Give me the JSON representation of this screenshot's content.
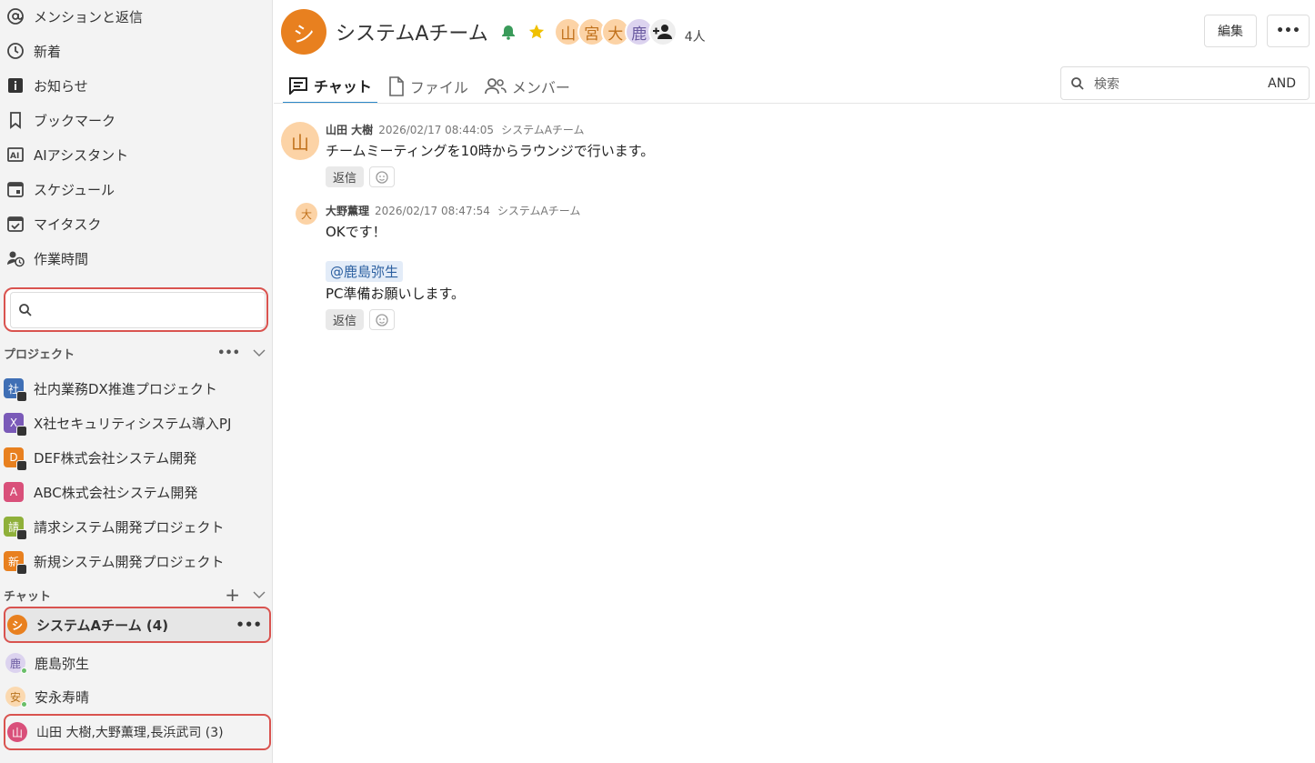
{
  "sidebar": {
    "nav": [
      {
        "label": "メンションと返信",
        "icon": "at-icon"
      },
      {
        "label": "新着",
        "icon": "clock-icon"
      },
      {
        "label": "お知らせ",
        "icon": "info-icon"
      },
      {
        "label": "ブックマーク",
        "icon": "bookmark-icon"
      },
      {
        "label": "AIアシスタント",
        "icon": "ai-icon"
      },
      {
        "label": "スケジュール",
        "icon": "calendar-icon"
      },
      {
        "label": "マイタスク",
        "icon": "task-icon"
      },
      {
        "label": "作業時間",
        "icon": "work-time-icon"
      }
    ],
    "search_placeholder": "",
    "projects_header": "プロジェクト",
    "projects": [
      {
        "label": "社内業務DX推進プロジェクト",
        "initial": "社",
        "color": "#3f6fb5"
      },
      {
        "label": "X社セキュリティシステム導入PJ",
        "initial": "X",
        "color": "#7a5ab8"
      },
      {
        "label": "DEF株式会社システム開発",
        "initial": "D",
        "color": "#e8801f"
      },
      {
        "label": "ABC株式会社システム開発",
        "initial": "A",
        "color": "#d9507a"
      },
      {
        "label": "請求システム開発プロジェクト",
        "initial": "請",
        "color": "#8fb03a"
      },
      {
        "label": "新規システム開発プロジェクト",
        "initial": "新",
        "color": "#e8801f"
      }
    ],
    "chat_header": "チャット",
    "chats": [
      {
        "label": "システムAチーム (4)",
        "initial": "シ",
        "bg": "#e8801f",
        "fg": "#ffffff"
      },
      {
        "label": "鹿島弥生",
        "initial": "鹿",
        "bg": "#dcd3ef",
        "fg": "#6a5aa0"
      },
      {
        "label": "安永寿晴",
        "initial": "安",
        "bg": "#fbd9b0",
        "fg": "#b8741f"
      },
      {
        "label": "山田 大樹,大野薫理,長浜武司 (3)",
        "initial": "山",
        "bg": "#d9507a",
        "fg": "#ffffff"
      }
    ]
  },
  "header": {
    "avatar_initial": "シ",
    "title": "システムAチーム",
    "members": [
      {
        "initial": "山",
        "bg": "#fcd3a6",
        "fg": "#c0701a"
      },
      {
        "initial": "宮",
        "bg": "#fcd3a6",
        "fg": "#c0701a"
      },
      {
        "initial": "大",
        "bg": "#fcd3a6",
        "fg": "#c0701a"
      },
      {
        "initial": "鹿",
        "bg": "#dcd3ef",
        "fg": "#6a5aa0"
      }
    ],
    "member_count": "4人",
    "edit_label": "編集",
    "more_label": "…"
  },
  "tabs": [
    {
      "label": "チャット"
    },
    {
      "label": "ファイル"
    },
    {
      "label": "メンバー"
    }
  ],
  "message_search": {
    "placeholder": "検索",
    "and_label": "AND"
  },
  "messages": [
    {
      "avatar": "山",
      "author": "山田 大樹",
      "time": "2026/02/17 08:44:05",
      "room": "システムAチーム",
      "text": "チームミーティングを10時からラウンジで行います。",
      "reply": "返信"
    },
    {
      "avatar": "大",
      "author": "大野薫理",
      "time": "2026/02/17 08:47:54",
      "room": "システムAチーム",
      "text": "OKです！",
      "mention": "@鹿島弥生",
      "text2": "PC準備お願いします。",
      "reply": "返信"
    }
  ]
}
